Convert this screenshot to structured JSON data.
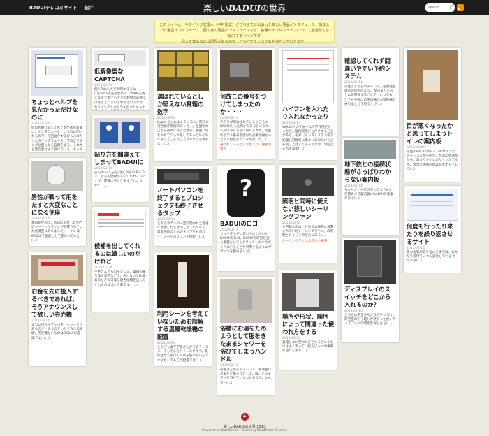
{
  "topnav": {
    "items": [
      "BADUIチレコミサイト",
      "紹介"
    ]
  },
  "site": {
    "title_prefix": "楽しい",
    "title_em": "BADUI",
    "title_suffix": "の世界"
  },
  "search": {
    "placeholder": "Search"
  },
  "notice": {
    "line1": "このサイトは、ネタイトが管理人（中村聡史）がこれまでに出会った楽しい悪品インタフェース、悩ましたれ悪品インタフェース、困の良の悪品インタフェースなど、各種のインタフェースについて整理がてら紹介するページです",
    "line2": "個人で集めるには限界があるので、こちらでチレコミもお待ちしております！"
  },
  "cards": [
    {
      "title": "ちょっとヘルプを見たかっただけなのに",
      "date": "2013/02/14",
      "body": "何度も繰り返してもですが基底の書い、インタフェースというのは困ったらので、今回紹介するのもんなだったらインタフェース、プログラミングに困ったら言葉をまる。それから発言者はよう調べないと、ネット接続がないので(...)"
    },
    {
      "title": "低解像度なCAPTCHA",
      "date": "2013/02/14",
      "body": "個人的にんだり利用するとなCaptcha認証は苦手で、SPAMを防ぐなぞですでもテンの利用の必要ではあるというのはわかるのですが、もう少し何とかならんのかといつも思います。今回紹介するのはそんな読むCAPTCHA、まだ正しく(...)"
    },
    {
      "title": "選ばれているとしか思えない靴箱の数字",
      "date": "2013/02/14",
      "body": "hyam.さんによるチレコミ。昨日に行き館き楽廊のロッカー。左面側の上から最高にあった数字。範囲に何を入れてロックをしてあってなるのに使うとこんなことがありうる数字な。(...)"
    },
    {
      "title": "何故この番号をつけてしまったのか・・・",
      "date": "2013/02/14",
      "body": "テアタが場合されているところにBADUIだった何かのあるというケースはありうるに限りますが。今回のホテル番号を付けた必要が紛かったのに付近をテアタが行いた。(...)",
      "link": "選ばれているとしか思えない靴箱の数字"
    },
    {
      "title": "ハイフンを入れたり入れなかったり",
      "date": "2013/02/14",
      "body": "Webの入力フォームで不作用定だったり、全角限定だったりすることがある。それ（インタ）ステム側で処理し可能性に構ついあのだけんども別ことはよくあるですが、今回はそれを表す(...)"
    },
    {
      "title": "確認してくれず間違いやすい予約システム",
      "date": "2013/02/14",
      "body": "学生さんからのチレコミ。短期連合目前の自宅のよう、Webよりシステムを用意することで、いつでもどこでも手軽に自宅の購入が新幹線の乗り換えが予約ですが(...)"
    },
    {
      "title": "貼り方を間違えてしまってBADUIに",
      "date": "2013/02/14",
      "body": "@nptsuda_yuji さんからのチレコミ。とある建物のトイレのサインですが、間違に気付きますでしょうか？（...）"
    },
    {
      "title": "ノートパソコンを終了するとプロジェクタも終了させるタップ",
      "date": "2013/02/14",
      "body": "とあるホテルの一室で開かれた会議に参加したときのこと、ホテルで、電源供給のためのタップをお借りて、ノートパソコンを接続。(...)"
    },
    {
      "title": "男性が戦って用をたすと大変なことになる便座",
      "date": "2013/02/14",
      "body": "本日紹介ので、昨日に紹介した別へのシーリングファンが設置されていた会議室にありました。トイレはBADUIで便座として使われていた(...)"
    },
    {
      "title": "候補を出してくれるのは嬉しいのだけれど",
      "date": "2013/02/14",
      "body": "学生さんからのチレコミ。電車の乗り換え案内などで、今となっては検索のときの可能な駅名候補を出してくれるのは当たり前です。(...)"
    },
    {
      "title": "BADUIのロゴ",
      "date": "2013/02/14",
      "body": "ツイやマトピに作っていただいたBADUIのロゴ。BADUIの研究を通じ書籍としてもクラッキングいただく人のいることを利用するようにデザインを頼みました(...)"
    },
    {
      "title": "照明と同時に使えない悲しいシーリングファン",
      "date": "2013/02/14",
      "body": "今回紹介のは、とある会議室に設置されていたシーリングファン。の照明とスイッチの部分にある(...)",
      "link": "シーリングファンの悲しい事例"
    },
    {
      "title": "地下鉄との接続状態がさっぱりわからない案内板",
      "date": "2013/02/14",
      "body": "ちかちかど付近のチレコミさんと、京都のバス案内板にBADUIの要素がある(...)"
    },
    {
      "title": "目が悪くなったかと思ってしまうトイレの案内板",
      "date": "2013/02/14",
      "body": "今回のBADUIがトイレのサインでのチレコミから紹介。昨日に会議室から、あまりトイレのサインがですが、緊急災害時の仮設を示すトイレで(...)"
    },
    {
      "title": "お金を先に投入するべきであれば、そうアナウンスして欲しい券売機",
      "date": "2013/02/14",
      "body": "本当に打ちがでヤバタ、ーションがあるのかと思うのでいたずらか自販機。券売機というのはBADUIの宝庫です。(...)"
    },
    {
      "title": "利用シーンを考えていないためお誤解する温風乾燥機の配置",
      "date": "2013/02/14",
      "body": "こちらも本学学生さんからのチレコミ。そしてまたトイレネタです。乾燥させておいての手を使いたいんですよね。でもこの配置では(...)"
    },
    {
      "title": "浴槽にお湯をためようとして服をきたままシャワーを浴びてしまうハンドル",
      "date": "2013/02/14",
      "body": "学生さんからのチレコミ。お風呂にお湯をためようとして、服ごとシャワーを浴びてしまったそうで、シャワー(...)"
    },
    {
      "title": "場所や形状、順序によって間違った使われ方をする",
      "date": "2013/02/14",
      "body": "書籍しない使われ方をするというものはよくあって、例えば一つの事例を紹介します(...)"
    },
    {
      "title": "ディスプレイのスイッチをどこから入れるのか？",
      "date": "2013/02/14",
      "body": "こちらは学生さんからのチレコミ。研究室の引っ越しが終わった後、ディスプレイの電源を探したら(...)"
    },
    {
      "title": "何度も行ったり来たりを繰り返させるサイト",
      "date": "2013/02/14",
      "body": "急な出張があり悩にこ本では、おかなり紙付でいつも変化している ホテルは(...)"
    }
  ],
  "footer": {
    "line1": "楽しいBADUIの世界 2013",
    "line2": "Powered by WordPress • Themeify WordPress Themes"
  }
}
